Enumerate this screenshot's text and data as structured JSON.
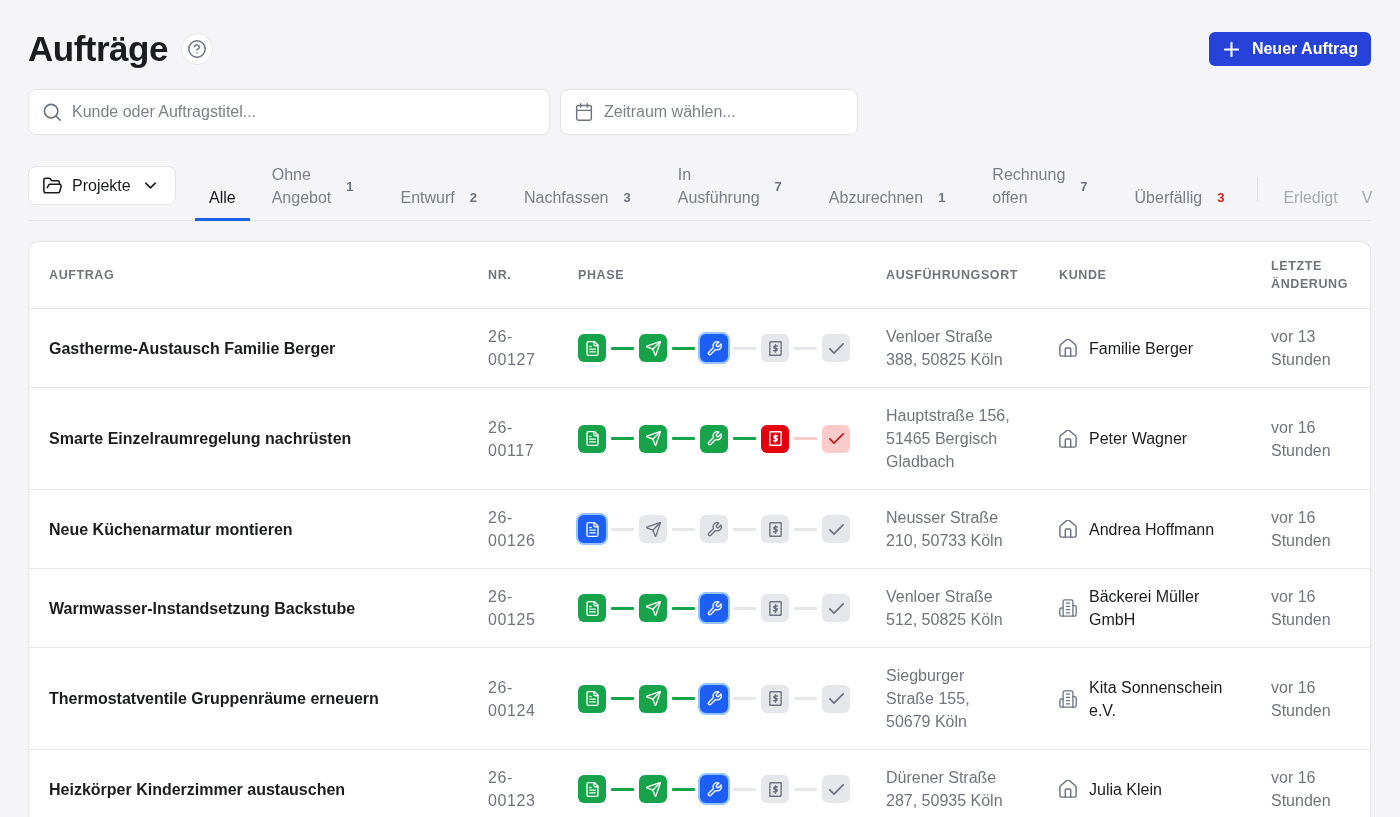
{
  "header": {
    "title": "Aufträge",
    "new_button": "Neuer Auftrag"
  },
  "search": {
    "placeholder": "Kunde oder Auftragstitel..."
  },
  "date_range": {
    "placeholder": "Zeitraum wählen..."
  },
  "project_filter": {
    "label": "Projekte"
  },
  "tabs": [
    {
      "label": "Alle",
      "kind": "status",
      "selected": true
    },
    {
      "label": "Ohne Angebot",
      "count": "1",
      "alert": false,
      "kind": "status",
      "selected": false
    },
    {
      "label": "Entwurf",
      "count": "2",
      "alert": false,
      "kind": "status",
      "selected": false
    },
    {
      "label": "Nachfassen",
      "count": "3",
      "alert": false,
      "kind": "status",
      "selected": false
    },
    {
      "label": "In Ausführung",
      "count": "7",
      "alert": false,
      "kind": "status",
      "selected": false
    },
    {
      "label": "Abzurechnen",
      "count": "1",
      "alert": false,
      "kind": "status",
      "selected": false
    },
    {
      "label": "Rechnung offen",
      "count": "7",
      "alert": false,
      "kind": "status",
      "selected": false
    },
    {
      "label": "Überfällig",
      "count": "3",
      "alert": true,
      "kind": "status",
      "selected": false
    },
    {
      "label": "Erledigt",
      "kind": "archive",
      "selected": false
    },
    {
      "label": "V",
      "kind": "archive",
      "selected": false
    }
  ],
  "table": {
    "columns": [
      "AUFTRAG",
      "NR.",
      "PHASE",
      "AUSFÜHRUNGSORT",
      "KUNDE",
      "LETZTE ÄNDERUNG"
    ],
    "rows": [
      {
        "title": "Gastherme-Austausch Familie Berger",
        "number": "26-00127",
        "phase": [
          {
            "kind": "done"
          },
          {
            "kind": "done"
          },
          {
            "kind": "current"
          },
          {
            "kind": "open"
          },
          {
            "kind": "open"
          }
        ],
        "location": "Venloer Straße 388, 50825 Köln",
        "customer": {
          "name": "Familie Berger",
          "kind": "private"
        },
        "updated": "vor 13 Stunden"
      },
      {
        "title": "Smarte Einzelraumregelung nachrüsten",
        "number": "26-00117",
        "phase": [
          {
            "kind": "done"
          },
          {
            "kind": "done"
          },
          {
            "kind": "done"
          },
          {
            "kind": "overdue"
          },
          {
            "kind": "blocked"
          }
        ],
        "location": "Hauptstraße 156, 51465 Bergisch Gladbach",
        "customer": {
          "name": "Peter Wagner",
          "kind": "private"
        },
        "updated": "vor 16 Stunden"
      },
      {
        "title": "Neue Küchenarmatur montieren",
        "number": "26-00126",
        "phase": [
          {
            "kind": "current"
          },
          {
            "kind": "open"
          },
          {
            "kind": "open"
          },
          {
            "kind": "open"
          },
          {
            "kind": "open"
          }
        ],
        "location": "Neusser Straße 210, 50733 Köln",
        "customer": {
          "name": "Andrea Hoffmann",
          "kind": "private"
        },
        "updated": "vor 16 Stunden"
      },
      {
        "title": "Warmwasser-Instandsetzung Backstube",
        "number": "26-00125",
        "phase": [
          {
            "kind": "done"
          },
          {
            "kind": "done"
          },
          {
            "kind": "current"
          },
          {
            "kind": "open"
          },
          {
            "kind": "open"
          }
        ],
        "location": "Venloer Straße 512, 50825 Köln",
        "customer": {
          "name": "Bäckerei Müller GmbH",
          "kind": "business"
        },
        "updated": "vor 16 Stunden"
      },
      {
        "title": "Thermostatventile Gruppenräume erneuern",
        "number": "26-00124",
        "phase": [
          {
            "kind": "done"
          },
          {
            "kind": "done"
          },
          {
            "kind": "current"
          },
          {
            "kind": "open"
          },
          {
            "kind": "open"
          }
        ],
        "location": "Siegburger Straße 155, 50679 Köln",
        "customer": {
          "name": "Kita Sonnenschein e.V.",
          "kind": "business"
        },
        "updated": "vor 16 Stunden"
      },
      {
        "title": "Heizkörper Kinderzimmer austauschen",
        "number": "26-00123",
        "phase": [
          {
            "kind": "done"
          },
          {
            "kind": "done"
          },
          {
            "kind": "current"
          },
          {
            "kind": "open"
          },
          {
            "kind": "open"
          }
        ],
        "location": "Dürener Straße 287, 50935 Köln",
        "customer": {
          "name": "Julia Klein",
          "kind": "private"
        },
        "updated": "vor 16 Stunden"
      }
    ]
  }
}
